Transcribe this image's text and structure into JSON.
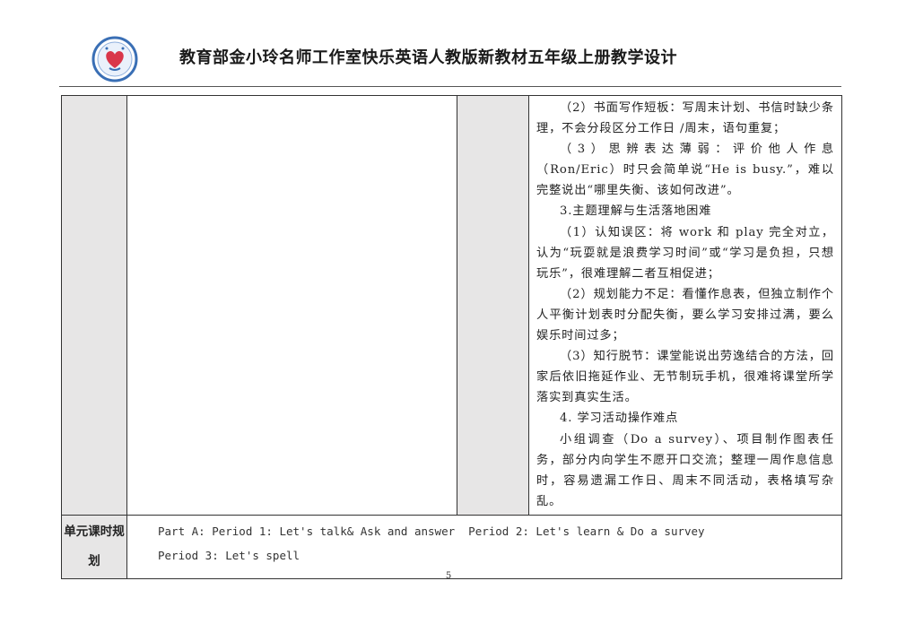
{
  "header": {
    "title": "教育部金小玲名师工作室快乐英语人教版新教材五年级上册教学设计",
    "logo_icon": "studio-seal-logo"
  },
  "difficulty_paragraphs": [
    "（2）书面写作短板：写周末计划、书信时缺少条理，不会分段区分工作日 /周末，语句重复；",
    "（3）思辨表达薄弱：评价他人作息（Ron/Eric）时只会简单说“He is busy.”，难以完整说出“哪里失衡、该如何改进”。",
    "3.主题理解与生活落地困难",
    "（1）认知误区：将 work 和 play 完全对立，认为“玩耍就是浪费学习时间”或“学习是负担，只想玩乐”，很难理解二者互相促进；",
    "（2）规划能力不足：看懂作息表，但独立制作个人平衡计划表时分配失衡，要么学习安排过满，要么娱乐时间过多；",
    "（3）知行脱节：课堂能说出劳逸结合的方法，回家后依旧拖延作业、无节制玩手机，很难将课堂所学落实到真实生活。",
    "4. 学习活动操作难点",
    "小组调查（Do a survey）、项目制作图表任务，部分内向学生不愿开口交流；整理一周作息信息时，容易遗漏工作日、周末不同活动，表格填写杂乱。"
  ],
  "plan_row": {
    "label": "单元课时规划",
    "lines": [
      "Part A: Period 1: Let's talk& Ask and answer  Period 2: Let's learn & Do a survey",
      "Period 3: Let's spell"
    ]
  },
  "page_number": "5",
  "colors": {
    "shade": "#e7e6e6",
    "border": "#333333",
    "logo_blue": "#3a6fb5",
    "logo_red": "#d9364a"
  }
}
